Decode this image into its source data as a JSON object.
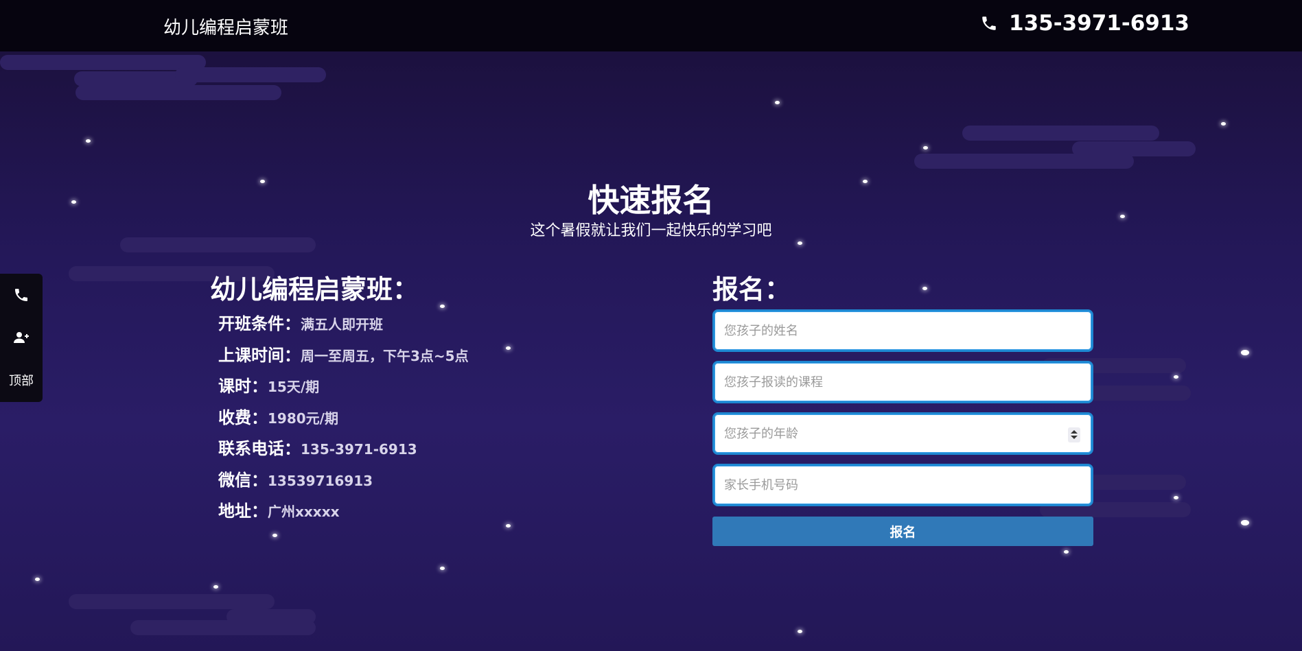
{
  "header": {
    "brand": "幼儿编程启蒙班",
    "phone": "135-3971-6913",
    "phone_icon": "phone-icon"
  },
  "hero": {
    "title": "快速报名",
    "subtitle": "这个暑假就让我们一起快乐的学习吧"
  },
  "info": {
    "title": "幼儿编程启蒙班：",
    "rows": [
      {
        "label": "开班条件：",
        "value": "满五人即开班"
      },
      {
        "label": "上课时间：",
        "value": "周一至周五，下午3点~5点"
      },
      {
        "label": "课时：",
        "value": "15天/期"
      },
      {
        "label": "收费：",
        "value": "1980元/期"
      },
      {
        "label": "联系电话：",
        "value": "135-3971-6913"
      },
      {
        "label": "微信：",
        "value": "13539716913"
      },
      {
        "label": "地址：",
        "value": "广州xxxxx"
      }
    ]
  },
  "form": {
    "title": "报名：",
    "fields": [
      {
        "placeholder": "您孩子的姓名",
        "value": ""
      },
      {
        "placeholder": "您孩子报读的课程",
        "value": ""
      },
      {
        "placeholder": "您孩子的年龄",
        "value": ""
      },
      {
        "placeholder": "家长手机号码",
        "value": ""
      }
    ],
    "submit_label": "报名"
  },
  "sidebar": {
    "items": [
      {
        "icon": "phone-icon"
      },
      {
        "icon": "add-user-icon"
      },
      {
        "label": "顶部"
      }
    ]
  },
  "colors": {
    "topbar": "#06040f",
    "background": "#24185a",
    "field_border": "#1e88d2",
    "button": "#3079b8"
  }
}
